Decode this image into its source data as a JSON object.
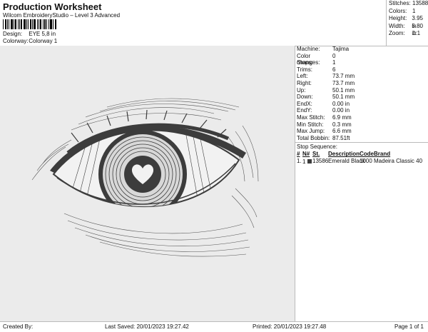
{
  "header": {
    "title": "Production Worksheet",
    "subtitle": "Wilcom EmbroideryStudio – Level 3 Advanced",
    "design_label": "Design:",
    "design_value": "EYE 5,8 in",
    "colorway_label": "Colorway:",
    "colorway_value": "Colorway 1"
  },
  "stats": [
    {
      "label": "Stitches:",
      "value": "13588"
    },
    {
      "label": "Colors:",
      "value": "1"
    },
    {
      "label": "Height:",
      "value": "3.95 in"
    },
    {
      "label": "Width:",
      "value": "5.80 in"
    },
    {
      "label": "Zoom:",
      "value": "1:1"
    }
  ],
  "machine_info": [
    {
      "label": "Machine:",
      "value": "Tajima"
    },
    {
      "label": "Color changes:",
      "value": "0"
    },
    {
      "label": "Stops:",
      "value": "1"
    },
    {
      "label": "Trims:",
      "value": "6"
    },
    {
      "label": "Left:",
      "value": "73.7 mm"
    },
    {
      "label": "Right:",
      "value": "73.7 mm"
    },
    {
      "label": "Up:",
      "value": "50.1 mm"
    },
    {
      "label": "Down:",
      "value": "50.1 mm"
    },
    {
      "label": "EndX:",
      "value": "0.00 in"
    },
    {
      "label": "EndY:",
      "value": "0.00 in"
    },
    {
      "label": "Max Stitch:",
      "value": "6.9 mm"
    },
    {
      "label": "Min Stitch:",
      "value": "0.3 mm"
    },
    {
      "label": "Max Jump:",
      "value": "6.6 mm"
    },
    {
      "label": "Total Bobbin:",
      "value": "87.51ft"
    }
  ],
  "stop_sequence": {
    "title": "Stop Sequence:",
    "headers": [
      "#",
      "N#",
      "St.",
      "Description",
      "Code",
      "Brand"
    ],
    "rows": [
      {
        "num": "1.",
        "n": "1",
        "st": "13586",
        "description": "Emerald Black",
        "code": "1000",
        "brand": "Madeira Classic 40",
        "color": "#3c3c3c"
      }
    ]
  },
  "footer": {
    "created": "Created By:",
    "last_saved": "Last Saved: 20/01/2023 19:27.42",
    "printed": "Printed: 20/01/2023 19:27.48",
    "page": "Page 1 of 1"
  },
  "colors": {
    "thread": "#3c3c3c",
    "background": "#ebebeb"
  }
}
